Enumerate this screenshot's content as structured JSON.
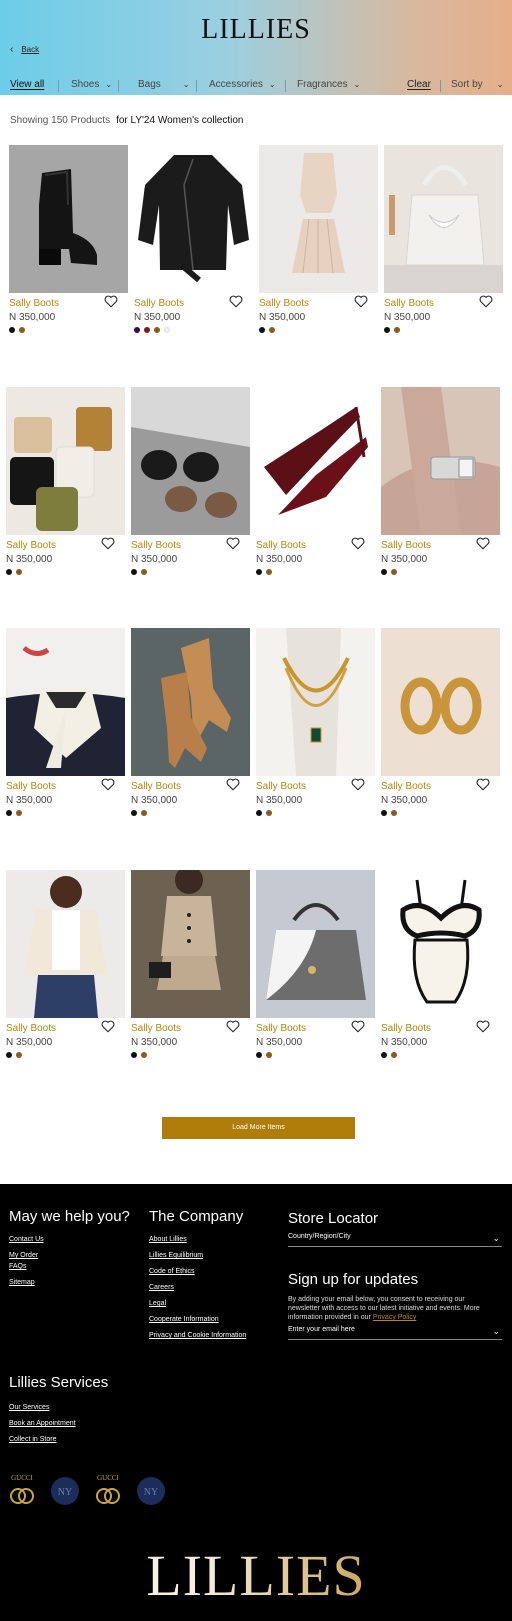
{
  "header": {
    "brand": "LILLIES",
    "back_label": "Back",
    "filters": {
      "view_all": "View all",
      "shoes": "Shoes",
      "bags": "Bags",
      "accessories": "Accessories",
      "fragrances": "Fragrances",
      "clear": "Clear",
      "sort_by": "Sort by"
    }
  },
  "listing": {
    "showing": "Showing 150 Products",
    "collection": "for LY'24 Women's collection"
  },
  "products": [
    {
      "name": "Sally Boots",
      "price": "N 350,000",
      "swatches": [
        "#111111",
        "#8b5a1e"
      ]
    },
    {
      "name": "Sally Boots",
      "price": "N 350,000",
      "swatches": [
        "#3a0a4a",
        "#7a1a1a",
        "#8b5a1e",
        "#f1f1f1"
      ]
    },
    {
      "name": "Sally Boots",
      "price": "N 350,000",
      "swatches": [
        "#111111",
        "#8b5a1e"
      ]
    },
    {
      "name": "Sally Boots",
      "price": "N 350,000",
      "swatches": [
        "#111111",
        "#8b5a1e"
      ]
    },
    {
      "name": "Sally Boots",
      "price": "N 350,000",
      "swatches": [
        "#111111",
        "#8b5a1e"
      ]
    },
    {
      "name": "Sally Boots",
      "price": "N 350,000",
      "swatches": [
        "#111111",
        "#8b5a1e"
      ]
    },
    {
      "name": "Sally Boots",
      "price": "N 350,000",
      "swatches": [
        "#111111",
        "#8b5a1e"
      ]
    },
    {
      "name": "Sally Boots",
      "price": "N 350,000",
      "swatches": [
        "#111111",
        "#8b5a1e"
      ]
    },
    {
      "name": "Sally Boots",
      "price": "N 350,000",
      "swatches": [
        "#111111",
        "#8b5a1e"
      ]
    },
    {
      "name": "Sally Boots",
      "price": "N 350,000",
      "swatches": [
        "#111111",
        "#8b5a1e"
      ]
    },
    {
      "name": "Sally Boots",
      "price": "N 350,000",
      "swatches": [
        "#111111",
        "#8b5a1e"
      ]
    },
    {
      "name": "Sally Boots",
      "price": "N 350,000",
      "swatches": [
        "#111111",
        "#8b5a1e"
      ]
    },
    {
      "name": "Sally Boots",
      "price": "N 350,000",
      "swatches": [
        "#111111",
        "#8b5a1e"
      ]
    },
    {
      "name": "Sally Boots",
      "price": "N 350,000",
      "swatches": [
        "#111111",
        "#8b5a1e"
      ]
    },
    {
      "name": "Sally Boots",
      "price": "N 350,000",
      "swatches": [
        "#111111",
        "#8b5a1e"
      ]
    },
    {
      "name": "Sally Boots",
      "price": "N 350,000",
      "swatches": [
        "#111111",
        "#8b5a1e"
      ]
    }
  ],
  "load_more": "Load More Items",
  "footer": {
    "help": {
      "title": "May we help you?",
      "links": [
        "Contact Us",
        "My Order",
        "FAQs",
        "Sitemap"
      ]
    },
    "company": {
      "title": "The Company",
      "links": [
        "About Lillies",
        "Lillies Equilibrium",
        "Code of Ethics",
        "Careers",
        "Legal",
        "Cooperate Information",
        "Privacy and Cookie Information"
      ]
    },
    "store": {
      "title": "Store Locator",
      "select": "Country/Region/City"
    },
    "signup": {
      "title": "Sign up for updates",
      "text": "By adding your email below, you consent to receiving our newsletter with access to our latest initiative and events. More information provided in our",
      "privacy": "Privacy Policy",
      "email_placeholder": "Enter your email here"
    },
    "services": {
      "title": "Lillies Services",
      "links": [
        "Our Services",
        "Book an Appointment",
        "Collect in Store"
      ]
    },
    "partner_logos": [
      "GUCCI",
      "NY",
      "GUCCI",
      "NY"
    ],
    "brand": "LILLIES"
  },
  "colors": {
    "accent_gold": "#b07d0a",
    "product_name": "#b8860b",
    "footer_bg": "#000000"
  }
}
